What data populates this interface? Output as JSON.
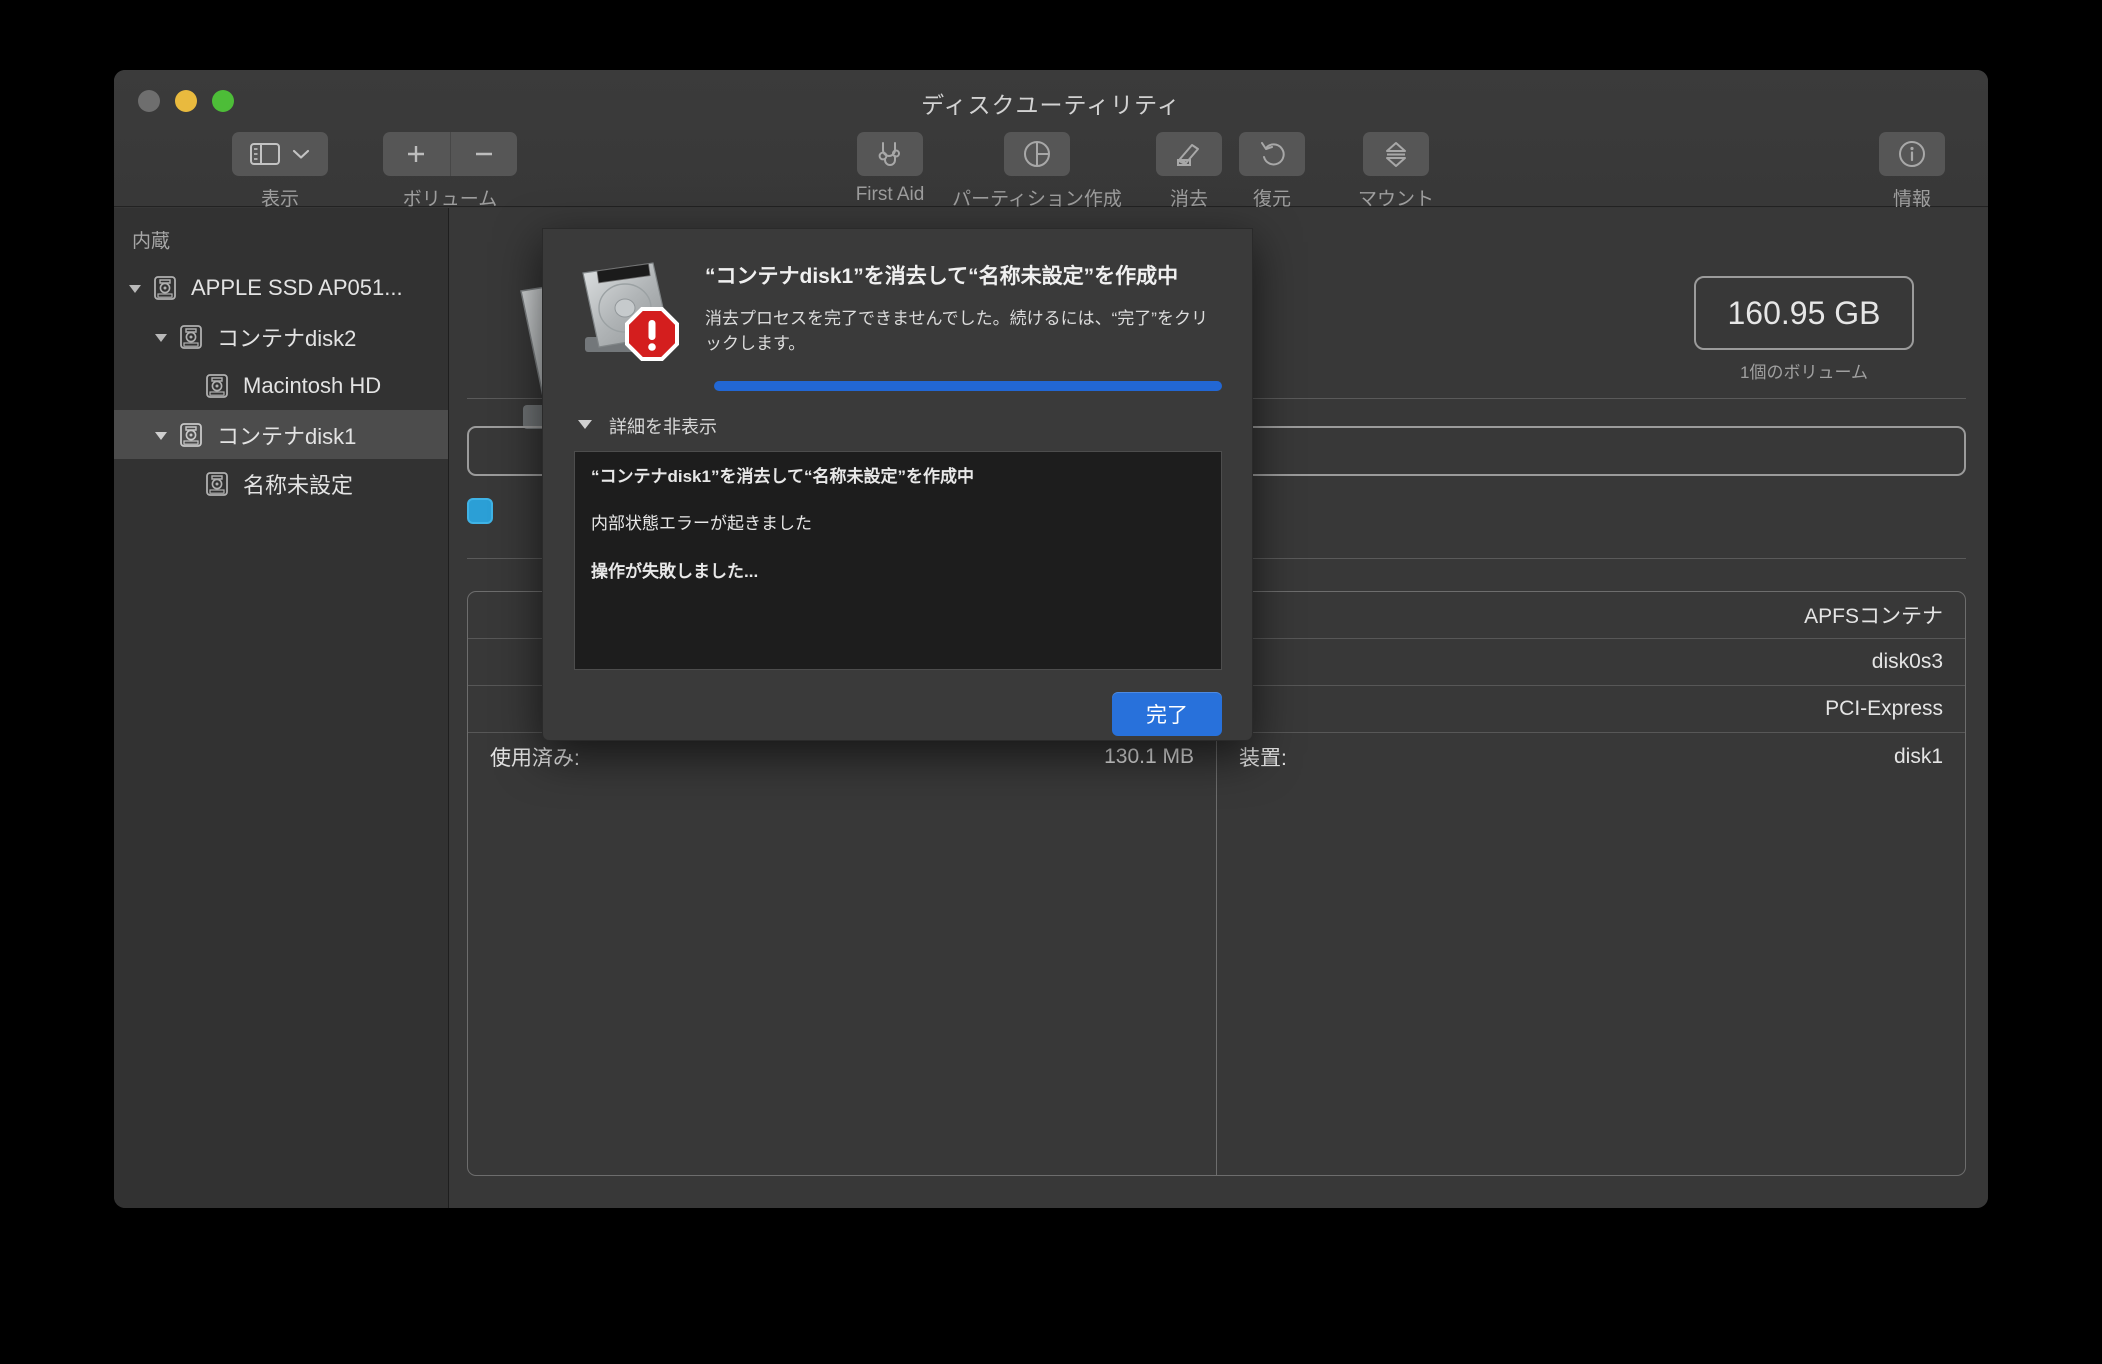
{
  "window": {
    "title": "ディスクユーティリティ",
    "traffic_lights": [
      "close",
      "minimize",
      "zoom"
    ]
  },
  "toolbar": {
    "view": {
      "label": "表示",
      "icon": "sidebar-icon"
    },
    "volume": {
      "label": "ボリューム",
      "add_icon": "plus-icon",
      "remove_icon": "minus-icon"
    },
    "first_aid": {
      "label": "First Aid",
      "icon": "stethoscope-icon"
    },
    "partition": {
      "label": "パーティション作成",
      "icon": "pie-chart-icon"
    },
    "erase": {
      "label": "消去",
      "icon": "erase-pencil-icon"
    },
    "restore": {
      "label": "復元",
      "icon": "undo-arrow-icon"
    },
    "mount": {
      "label": "マウント",
      "icon": "eject-icon"
    },
    "info": {
      "label": "情報",
      "icon": "info-circle-icon"
    }
  },
  "sidebar": {
    "section_header": "内蔵",
    "items": [
      {
        "label": "APPLE SSD AP051...",
        "indent": 1,
        "expanded": true,
        "selected": false
      },
      {
        "label": "コンテナdisk2",
        "indent": 2,
        "expanded": true,
        "selected": false
      },
      {
        "label": "Macintosh HD",
        "indent": 3,
        "expanded": null,
        "selected": false
      },
      {
        "label": "コンテナdisk1",
        "indent": 2,
        "expanded": true,
        "selected": true
      },
      {
        "label": "名称未設定",
        "indent": 3,
        "expanded": null,
        "selected": false
      }
    ]
  },
  "main": {
    "capacity": "160.95 GB",
    "capacity_sub": "1個のボリューム",
    "info_rows_left": [
      {
        "key": "",
        "value": ""
      },
      {
        "key": "",
        "value": ""
      },
      {
        "key": "",
        "value": ""
      },
      {
        "key": "使用済み:",
        "value": "130.1 MB"
      }
    ],
    "info_rows_right": [
      {
        "key": "",
        "value": "APFSコンテナ"
      },
      {
        "key": "",
        "value": "disk0s3"
      },
      {
        "key": "",
        "value": "PCI-Express"
      },
      {
        "key": "装置:",
        "value": "disk1"
      }
    ]
  },
  "sheet": {
    "icon": "hard-disk-with-alert-icon",
    "title": "“コンテナdisk1”を消去して“名称未設定”を作成中",
    "message": "消去プロセスを完了できませんでした。続けるには、“完了”をクリックします。",
    "progress_percent": 100,
    "disclosure_label": "詳細を非表示",
    "disclosure_state": "expanded",
    "log_lines": [
      {
        "text": "“コンテナdisk1”を消去して“名称未設定”を作成中",
        "bold": true
      },
      {
        "text": "内部状態エラーが起きました",
        "bold": false
      },
      {
        "text": "操作が失敗しました...",
        "bold": true
      }
    ],
    "done_button": "完了"
  },
  "colors": {
    "accent_blue": "#2871db",
    "progress_blue": "#2267d4",
    "alert_red": "#d41e1e",
    "window_bg": "#373737",
    "sidebar_bg": "#323232",
    "selected_row": "#4c4c4c"
  }
}
